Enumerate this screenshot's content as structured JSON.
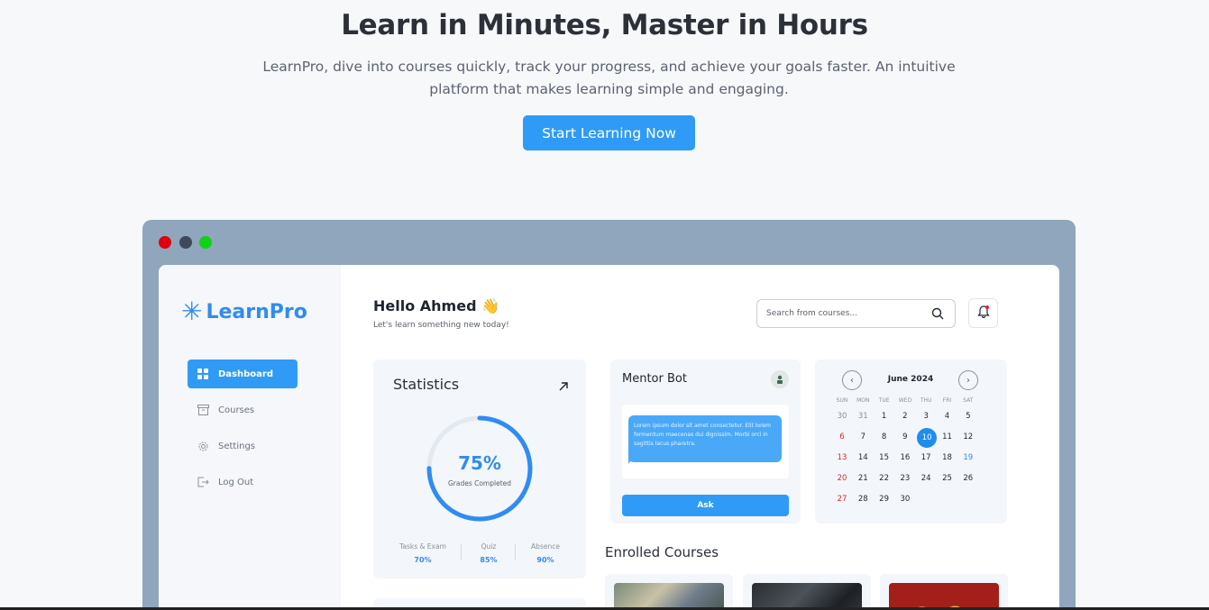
{
  "hero": {
    "title": "Learn in Minutes, Master in Hours",
    "subtitle_line1": "LearnPro, dive into courses quickly, track your progress, and achieve your goals faster. An intuitive",
    "subtitle_line2": "platform that makes learning simple and engaging.",
    "cta_label": "Start Learning Now"
  },
  "window": {
    "dots": [
      "#e0000f",
      "#3e4a5c",
      "#0fd314"
    ]
  },
  "sidebar": {
    "logo_text": "LearnPro",
    "items": [
      {
        "label": "Dashboard",
        "icon": "grid-icon",
        "active": true
      },
      {
        "label": "Courses",
        "icon": "archive-icon",
        "active": false
      },
      {
        "label": "Settings",
        "icon": "gear-icon",
        "active": false
      },
      {
        "label": "Log Out",
        "icon": "logout-icon",
        "active": false
      }
    ]
  },
  "header": {
    "greeting": "Hello Ahmed 👋",
    "subtext": "Let's learn something new today!",
    "search_placeholder": "Search from courses..."
  },
  "statistics": {
    "title": "Statistics",
    "progress_value": "75%",
    "progress_fraction": 0.75,
    "progress_label": "Grades Completed",
    "metrics": [
      {
        "label": "Tasks & Exam",
        "value": "70%"
      },
      {
        "label": "Quiz",
        "value": "85%"
      },
      {
        "label": "Absence",
        "value": "90%"
      }
    ]
  },
  "mentor_bot": {
    "title": "Mentor Bot",
    "message": "Lorem ipsum dolor sit amet consectetur. Elit lorem fermentum maecenas dui dignissim. Morbi orci in sagittis lacus pharetra.",
    "ask_label": "Ask"
  },
  "calendar": {
    "month": "June 2024",
    "weekdays": [
      "SUN",
      "MON",
      "TUE",
      "WED",
      "THU",
      "FRI",
      "SAT"
    ],
    "weeks": [
      [
        "30",
        "31",
        "1",
        "2",
        "3",
        "4",
        "5"
      ],
      [
        "6",
        "7",
        "8",
        "9",
        "10",
        "11",
        "12"
      ],
      [
        "13",
        "14",
        "15",
        "16",
        "17",
        "18",
        "19"
      ],
      [
        "20",
        "21",
        "22",
        "23",
        "24",
        "25",
        "26"
      ],
      [
        "27",
        "28",
        "29",
        "30",
        "",
        "",
        ""
      ]
    ],
    "selected_day": "10",
    "colors": {
      "sunday": "#e02424",
      "saturday_highlight": "#2f8cf0",
      "muted": "#8a909c",
      "selected_bg": "#1f8cf0"
    }
  },
  "enrolled": {
    "title": "Enrolled Courses"
  },
  "colors": {
    "accent": "#2f9bf6",
    "browser_frame": "#8fa6bd"
  }
}
